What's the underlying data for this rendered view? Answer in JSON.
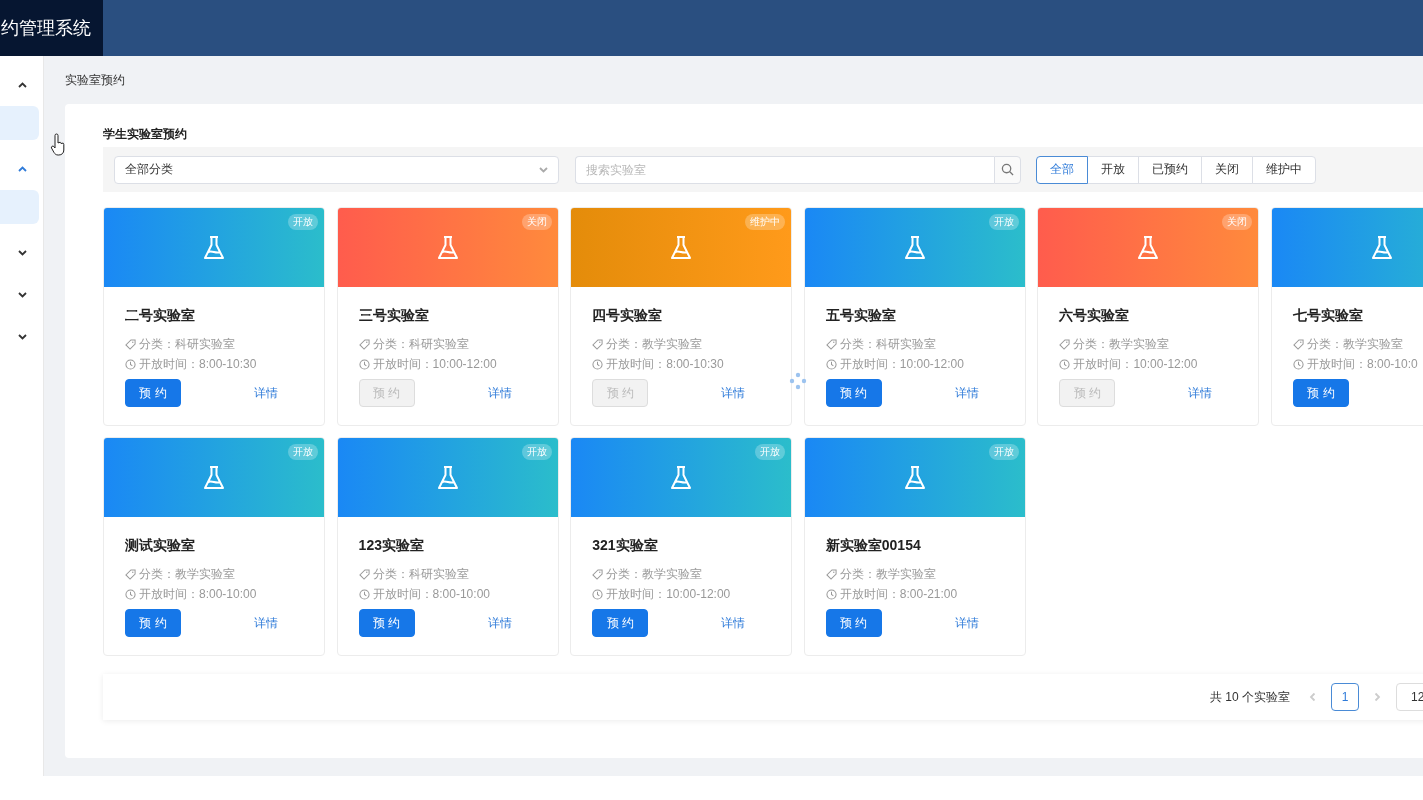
{
  "header": {
    "title": "约管理系统"
  },
  "sidebar": {
    "groups": [
      {
        "expanded": true,
        "items": [
          {
            "selected": true
          }
        ]
      },
      {
        "expanded": true,
        "items": [
          {
            "selected": true
          }
        ]
      },
      {
        "expanded": false
      },
      {
        "expanded": false
      },
      {
        "expanded": false
      }
    ]
  },
  "breadcrumb": "实验室预约",
  "panel": {
    "title": "学生实验室预约",
    "category_select": {
      "value": "全部分类"
    },
    "search": {
      "placeholder": "搜索实验室"
    },
    "filters": [
      {
        "label": "全部",
        "selected": true
      },
      {
        "label": "开放",
        "selected": false
      },
      {
        "label": "已预约",
        "selected": false
      },
      {
        "label": "关闭",
        "selected": false
      },
      {
        "label": "维护中",
        "selected": false
      }
    ],
    "labs": [
      {
        "name": "二号实验室",
        "kind": "open",
        "badge": "开放",
        "category": "分类：科研实验室",
        "hours": "开放时间：8:00-10:30",
        "book": "预 约",
        "disabled": false,
        "detail": "详情"
      },
      {
        "name": "三号实验室",
        "kind": "closed",
        "badge": "关闭",
        "category": "分类：科研实验室",
        "hours": "开放时间：10:00-12:00",
        "book": "预 约",
        "disabled": true,
        "detail": "详情"
      },
      {
        "name": "四号实验室",
        "kind": "maintenance",
        "badge": "维护中",
        "category": "分类：教学实验室",
        "hours": "开放时间：8:00-10:30",
        "book": "预 约",
        "disabled": true,
        "detail": "详情"
      },
      {
        "name": "五号实验室",
        "kind": "open",
        "badge": "开放",
        "category": "分类：科研实验室",
        "hours": "开放时间：10:00-12:00",
        "book": "预 约",
        "disabled": false,
        "detail": "详情"
      },
      {
        "name": "六号实验室",
        "kind": "closed",
        "badge": "关闭",
        "category": "分类：教学实验室",
        "hours": "开放时间：10:00-12:00",
        "book": "预 约",
        "disabled": true,
        "detail": "详情"
      },
      {
        "name": "七号实验室",
        "kind": "open",
        "category": "分类：教学实验室",
        "hours": "开放时间：8:00-10:0",
        "book": "预 约",
        "disabled": false
      },
      {
        "name": "测试实验室",
        "kind": "open",
        "badge": "开放",
        "category": "分类：教学实验室",
        "hours": "开放时间：8:00-10:00",
        "book": "预 约",
        "disabled": false,
        "detail": "详情"
      },
      {
        "name": "123实验室",
        "kind": "open",
        "badge": "开放",
        "category": "分类：科研实验室",
        "hours": "开放时间：8:00-10:00",
        "book": "预 约",
        "disabled": false,
        "detail": "详情"
      },
      {
        "name": "321实验室",
        "kind": "open",
        "badge": "开放",
        "category": "分类：教学实验室",
        "hours": "开放时间：10:00-12:00",
        "book": "预 约",
        "disabled": false,
        "detail": "详情"
      },
      {
        "name": "新实验室00154",
        "kind": "open",
        "badge": "开放",
        "category": "分类：教学实验室",
        "hours": "开放时间：8:00-21:00",
        "book": "预 约",
        "disabled": false,
        "detail": "详情"
      }
    ],
    "pagination": {
      "total": "共 10 个实验室",
      "pages": [
        {
          "label": "1",
          "selected": true
        }
      ],
      "page_size": "12"
    }
  }
}
